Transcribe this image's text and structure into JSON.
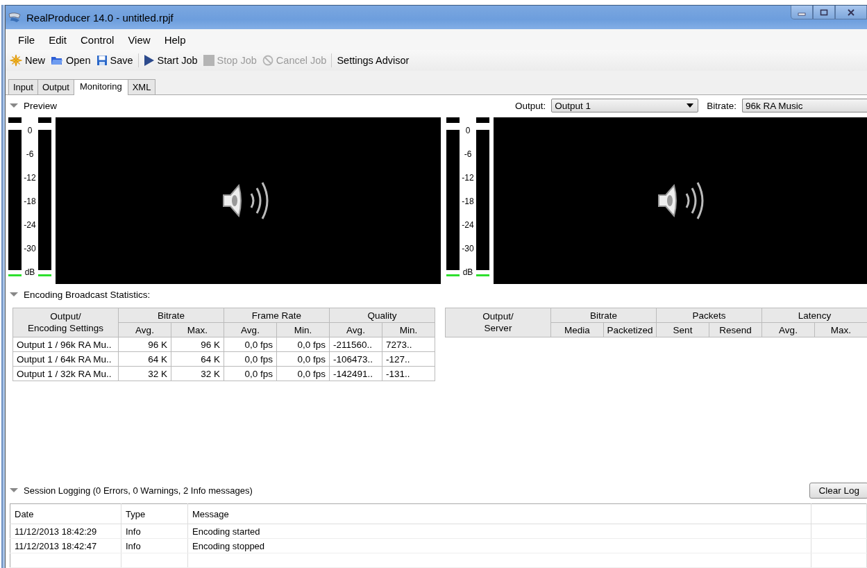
{
  "window": {
    "title": "RealProducer 14.0 - untitled.rpjf"
  },
  "menu": [
    "File",
    "Edit",
    "Control",
    "View",
    "Help"
  ],
  "toolbar": {
    "groups": [
      [
        {
          "label": "New",
          "disabled": false
        },
        {
          "label": "Open",
          "disabled": false
        },
        {
          "label": "Save",
          "disabled": false
        }
      ],
      [
        {
          "label": "Start Job",
          "disabled": false
        },
        {
          "label": "Stop Job",
          "disabled": true
        },
        {
          "label": "Cancel Job",
          "disabled": true
        }
      ],
      [
        {
          "label": "Settings Advisor",
          "disabled": false
        }
      ]
    ]
  },
  "tabs": [
    {
      "label": "Input",
      "selected": false
    },
    {
      "label": "Output",
      "selected": false
    },
    {
      "label": "Monitoring",
      "selected": true
    },
    {
      "label": "XML",
      "selected": false
    }
  ],
  "preview": {
    "title": "Preview",
    "expanded": true,
    "output_label": "Output:",
    "output_value": "Output 1",
    "bitrate_label": "Bitrate:",
    "bitrate_value": "96k RA Music",
    "panels": [
      {
        "scale": [
          "0",
          "-6",
          "-12",
          "-18",
          "-24",
          "-30"
        ],
        "unit": "dB"
      },
      {
        "scale": [
          "0",
          "-6",
          "-12",
          "-18",
          "-24",
          "-30"
        ],
        "unit": "dB"
      }
    ]
  },
  "statistics": {
    "title": "Encoding  Broadcast Statistics:",
    "expanded": true,
    "encoding_table": {
      "first_column": "Output/\nEncoding Settings",
      "groups": [
        {
          "label": "Bitrate",
          "columns": [
            "Avg.",
            "Max."
          ]
        },
        {
          "label": "Frame Rate",
          "columns": [
            "Avg.",
            "Min."
          ]
        },
        {
          "label": "Quality",
          "columns": [
            "Avg.",
            "Min."
          ]
        }
      ],
      "rows": [
        [
          "Output 1 / 96k RA Mu..",
          "96 K",
          "96 K",
          "0,0 fps",
          "0,0 fps",
          "-211560..",
          "7273.."
        ],
        [
          "Output 1 / 64k RA Mu..",
          "64 K",
          "64 K",
          "0,0 fps",
          "0,0 fps",
          "-106473..",
          "-127.."
        ],
        [
          "Output 1 / 32k RA Mu..",
          "32 K",
          "32 K",
          "0,0 fps",
          "0,0 fps",
          "-142491..",
          "-131.."
        ]
      ]
    },
    "server_table": {
      "first_column": "Output/\nServer",
      "groups": [
        {
          "label": "Bitrate",
          "columns": [
            "Media",
            "Packetized"
          ]
        },
        {
          "label": "Packets",
          "columns": [
            "Sent",
            "Resend"
          ]
        },
        {
          "label": "Latency",
          "columns": [
            "Avg.",
            "Max."
          ]
        }
      ]
    }
  },
  "session_logging": {
    "title": "Session Logging (0 Errors, 0 Warnings, 2 Info messages)",
    "expanded": true,
    "clear_button": "Clear Log",
    "columns": [
      "Date",
      "Type",
      "Message"
    ],
    "rows": [
      {
        "date": "11/12/2013 18:42:29",
        "type": "Info",
        "message": "Encoding started"
      },
      {
        "date": "11/12/2013 18:42:47",
        "type": "Info",
        "message": "Encoding stopped"
      }
    ]
  }
}
